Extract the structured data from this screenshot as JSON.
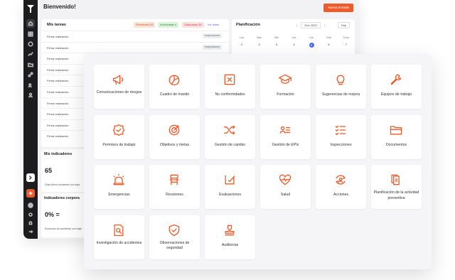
{
  "header": {
    "welcome": "Bienvenido!",
    "new_button": "Nueva entrada"
  },
  "tasks": {
    "title": "Mis tareas",
    "pills": {
      "pending": "Pendientes 65",
      "authorized": "Autorizadas 4",
      "expired": "Caducadas 35"
    },
    "see_all": "Ver todas",
    "rows": [
      {
        "label": "Firma realización",
        "tag": "Inspecciones"
      },
      {
        "label": "Firma realización",
        "tag": "Inspecciones"
      },
      {
        "label": "Firma realización",
        "tag": ""
      },
      {
        "label": "Firma realización",
        "tag": ""
      },
      {
        "label": "Firma realización",
        "tag": ""
      },
      {
        "label": "Firma realización",
        "tag": ""
      },
      {
        "label": "Firma realización",
        "tag": ""
      },
      {
        "label": "Firma realización",
        "tag": ""
      },
      {
        "label": "Firma realización",
        "tag": ""
      },
      {
        "label": "Firma realización",
        "tag": ""
      }
    ]
  },
  "planning": {
    "title": "Planificación",
    "prev": "‹",
    "date": "Ene 2023",
    "next": "›",
    "today": "Hoy",
    "days": [
      "Lun",
      "Mar",
      "Mié",
      "Jue",
      "Vie",
      "Sáb",
      "Dom"
    ],
    "dates": [
      "2",
      "3",
      "3",
      "4",
      "5",
      "6",
      "7"
    ],
    "highlight_index": 4
  },
  "indicators": {
    "title": "Mis indicadores",
    "value": "65",
    "subtitle": "Días último accidente con baja"
  },
  "corporate": {
    "title": "Indicadores corpora",
    "value": "0% =",
    "subtitle": "Evolución de accidente con baja"
  },
  "modules": [
    {
      "label": "Comunicaciones de riesgos",
      "icon": "megaphone-icon"
    },
    {
      "label": "Cuadro de mando",
      "icon": "dashboard-chart-icon"
    },
    {
      "label": "No conformidades",
      "icon": "x-square-icon"
    },
    {
      "label": "Formación",
      "icon": "graduation-cap-icon"
    },
    {
      "label": "Sugerencias de mejora",
      "icon": "lightbulb-icon"
    },
    {
      "label": "Equipos de trabajo",
      "icon": "wrench-icon"
    },
    {
      "label": "Permisos de trabajo",
      "icon": "badge-check-icon"
    },
    {
      "label": "Objetivos y metas",
      "icon": "target-icon"
    },
    {
      "label": "Gestión de cambio",
      "icon": "shuffle-icon"
    },
    {
      "label": "Gestión de EPIs",
      "icon": "id-card-icon"
    },
    {
      "label": "Inspecciones",
      "icon": "checklist-icon"
    },
    {
      "label": "Documentos",
      "icon": "folder-icon"
    },
    {
      "label": "Emergencias",
      "icon": "siren-icon"
    },
    {
      "label": "Reuniones",
      "icon": "chair-icon"
    },
    {
      "label": "Evaluaciones",
      "icon": "evaluation-icon"
    },
    {
      "label": "Salud",
      "icon": "heart-pulse-icon"
    },
    {
      "label": "Acciones",
      "icon": "cycle-user-icon"
    },
    {
      "label": "Planificación de la actividad preventiva",
      "icon": "clipboard-doc-icon"
    },
    {
      "label": "Investigación de accidentes",
      "icon": "search-doc-icon"
    },
    {
      "label": "Observaciones de seguridad",
      "icon": "shield-check-icon"
    },
    {
      "label": "Auditorías",
      "icon": "stamp-icon"
    }
  ],
  "colors": {
    "accent": "#ef5a2a",
    "sidebar": "#1c1c1e",
    "link": "#4a6cf7"
  }
}
